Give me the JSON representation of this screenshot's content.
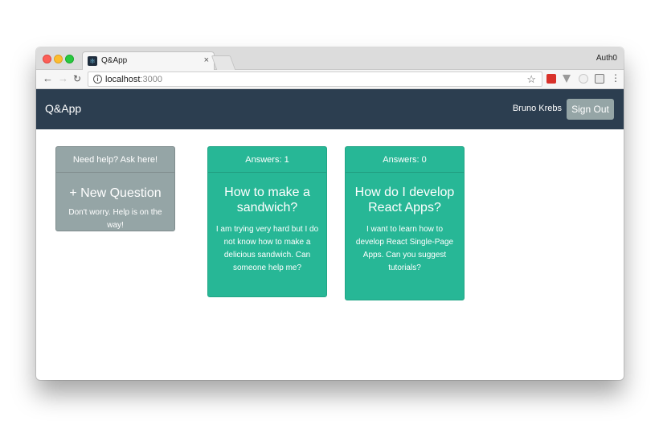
{
  "browser": {
    "tab_title": "Q&App",
    "tab_close": "×",
    "profile_label": "Auth0",
    "url_host": "localhost",
    "url_port": ":3000",
    "icons": {
      "back": "arrow-left",
      "forward": "arrow-right",
      "reload": "reload",
      "info": "info-circle",
      "star": "star",
      "menu": "kebab"
    }
  },
  "navbar": {
    "brand": "Q&App",
    "username": "Bruno Krebs",
    "signout_label": "Sign Out"
  },
  "cards": {
    "new": {
      "header": "Need help? Ask here!",
      "title": "+ New Question",
      "text": "Don't worry. Help is on the way!"
    },
    "questions": [
      {
        "header": "Answers: 1",
        "title": "How to make a sandwich?",
        "text": "I am trying very hard but I do not know how to make a delicious sandwich. Can someone help me?"
      },
      {
        "header": "Answers: 0",
        "title": "How do I develop React Apps?",
        "text": "I want to learn how to develop React Single-Page Apps. Can you suggest tutorials?"
      }
    ]
  },
  "colors": {
    "navbar_bg": "#2c3e50",
    "card_new_bg": "#95a5a6",
    "card_question_bg": "#27b796",
    "signout_bg": "#95a5a6"
  }
}
